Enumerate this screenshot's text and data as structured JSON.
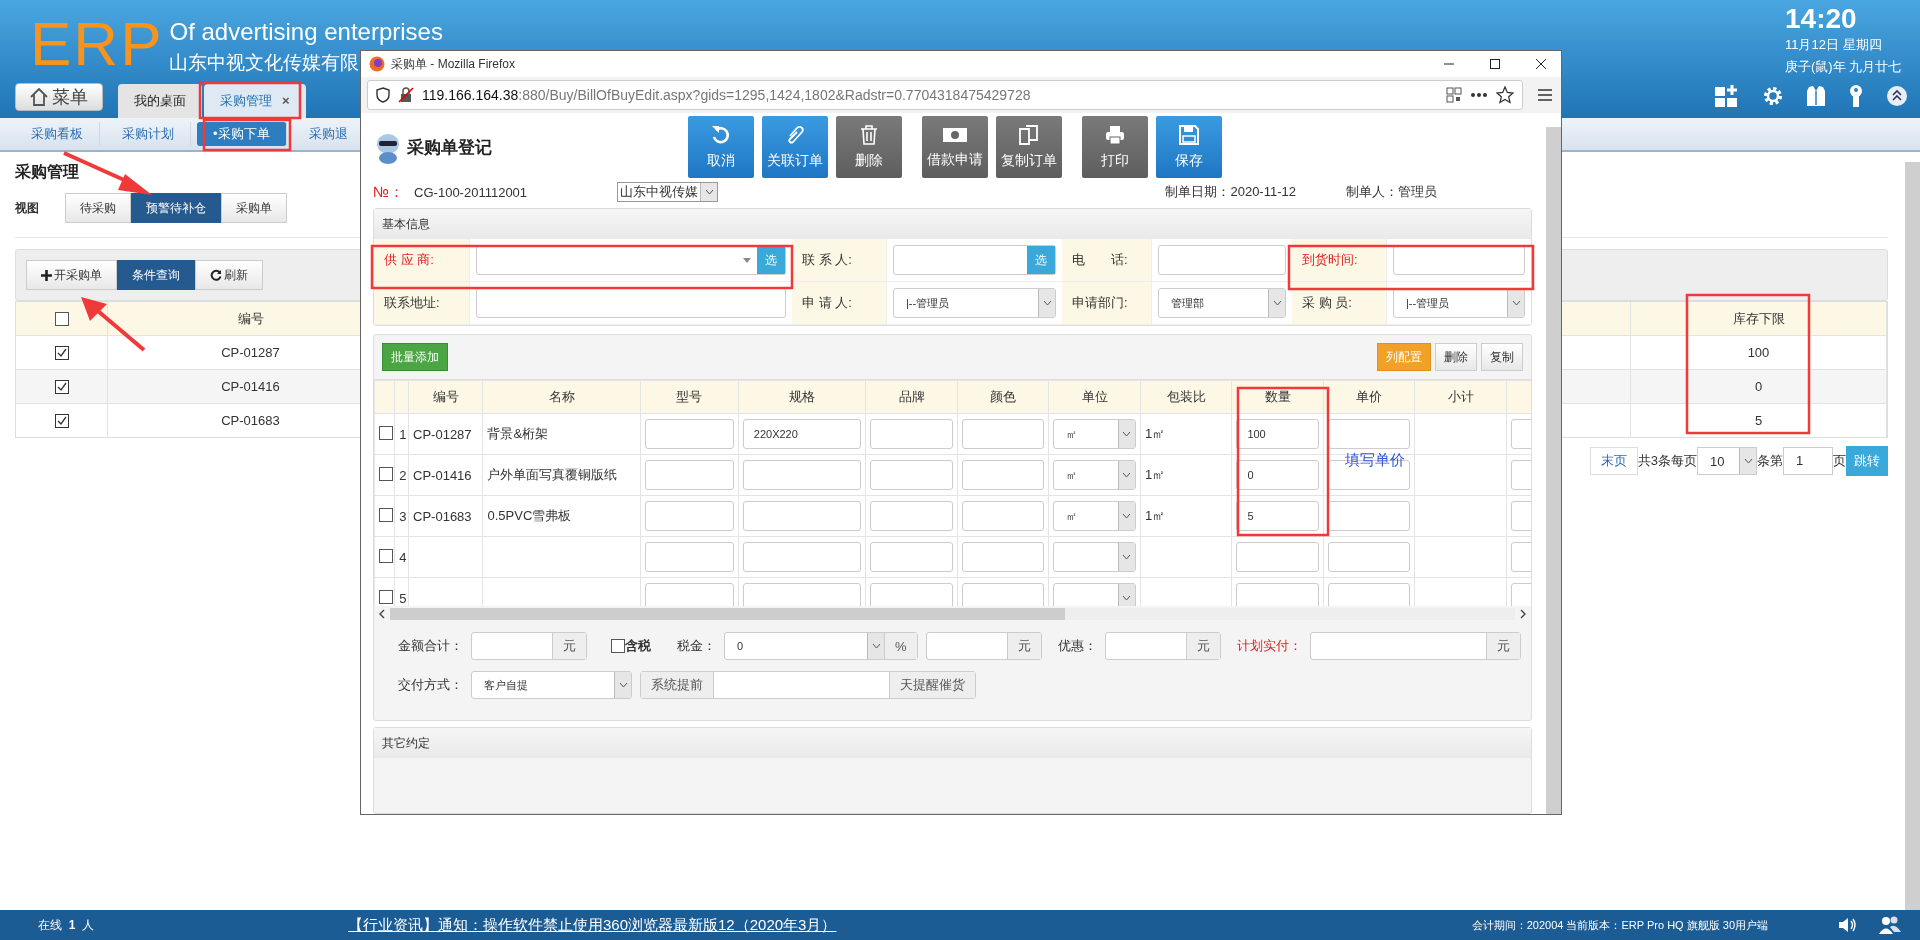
{
  "header": {
    "logo": "ERP",
    "title": "Of advertising enterprises",
    "subtitle": "山东中视文化传媒有限",
    "time": "14:20",
    "date": "11月12日 星期四",
    "lunar": "庚子(鼠)年 九月廿七"
  },
  "menu_button": "菜单",
  "tabs": [
    {
      "label": "我的桌面",
      "selected": false
    },
    {
      "label": "采购管理",
      "selected": true,
      "close": "×"
    }
  ],
  "subnav": [
    {
      "label": "采购看板",
      "selected": false
    },
    {
      "label": "采购计划",
      "selected": false
    },
    {
      "label": "•采购下单",
      "selected": true
    },
    {
      "label": "采购退",
      "selected": false
    }
  ],
  "page": {
    "title": "采购管理",
    "view_label": "视图",
    "views": [
      {
        "label": "待采购",
        "selected": false
      },
      {
        "label": "预警待补仓",
        "selected": true
      },
      {
        "label": "采购单",
        "selected": false
      }
    ],
    "toolbar": [
      {
        "label": "开采购单",
        "selected": false
      },
      {
        "label": "条件查询",
        "selected": true
      },
      {
        "label": "刷新",
        "selected": false
      }
    ],
    "table": {
      "header_checked": false,
      "columns": [
        "编号",
        "库存下限"
      ],
      "rows": [
        {
          "checked": true,
          "code": "CP-01287",
          "stock_min": "100"
        },
        {
          "checked": true,
          "code": "CP-01416",
          "stock_min": "0"
        },
        {
          "checked": true,
          "code": "CP-01683",
          "stock_min": "5"
        }
      ]
    },
    "pager": {
      "last": "末页",
      "total": "共3条每页",
      "size": "10",
      "page_prefix": "条第",
      "page": "1",
      "page_suffix": "页",
      "go": "跳转"
    }
  },
  "popup": {
    "title": "采购单 - Mozilla Firefox",
    "url_host": "119.166.164.38",
    "url_rest": ":880/Buy/BillOfBuyEdit.aspx?gids=1295,1424,1802&Radstr=0.7704318475429728",
    "form_title": "采购单登记",
    "actions": [
      "取消",
      "关联订单",
      "删除",
      "借款申请",
      "复制订单",
      "打印",
      "保存"
    ],
    "number_label": "№：",
    "number": "CG-100-201112001",
    "company": "山东中视传媒",
    "date": "制单日期：2020-11-12",
    "maker": "制单人：管理员",
    "basic_title": "基本信息",
    "fields": [
      {
        "label": "供 应 商:",
        "highlight": true,
        "kind": "combo",
        "button": "选"
      },
      {
        "label": "联 系 人:",
        "highlight": false,
        "kind": "pick",
        "button": "选"
      },
      {
        "label": "电　　话:",
        "highlight": false,
        "kind": "text"
      },
      {
        "label": "到货时间:",
        "highlight": true,
        "kind": "text"
      },
      {
        "label": "联系地址:",
        "highlight": false,
        "kind": "text"
      },
      {
        "label": "申 请 人:",
        "highlight": false,
        "kind": "select",
        "value": "|--管理员"
      },
      {
        "label": "申请部门:",
        "highlight": false,
        "kind": "select",
        "value": "管理部"
      },
      {
        "label": "采 购 员:",
        "highlight": false,
        "kind": "select",
        "value": "|--管理员"
      }
    ],
    "batch_add": "批量添加",
    "right_buttons": [
      "列配置",
      "删除",
      "复制"
    ],
    "columns": [
      "编号",
      "名称",
      "型号",
      "规格",
      "品牌",
      "颜色",
      "单位",
      "包装比",
      "数量",
      "单价",
      "小计"
    ],
    "rows": [
      {
        "checked": false,
        "no": "1",
        "code": "CP-01287",
        "name": "背景&桁架",
        "spec": "220X220",
        "unit": "㎡",
        "pack": "1㎡",
        "qty": "100"
      },
      {
        "checked": false,
        "no": "2",
        "code": "CP-01416",
        "name": "户外单面写真覆铜版纸",
        "unit": "㎡",
        "pack": "1㎡",
        "qty": "0"
      },
      {
        "checked": false,
        "no": "3",
        "code": "CP-01683",
        "name": "0.5PVC雪弗板",
        "unit": "㎡",
        "pack": "1㎡",
        "qty": "5"
      },
      {
        "checked": false,
        "no": "4"
      },
      {
        "checked": false,
        "no": "5"
      }
    ],
    "note": "填写单价",
    "totals": [
      {
        "kind": "input_unit",
        "label": "金额合计：",
        "highlight": false,
        "unit": "元"
      },
      {
        "kind": "checkbox",
        "label": "含税",
        "checked": false
      },
      {
        "kind": "select_unit",
        "label": "税金：",
        "value": "0",
        "unit": "%"
      },
      {
        "kind": "input_unit",
        "unit": "元"
      },
      {
        "kind": "input_unit",
        "label": "优惠：",
        "highlight": false,
        "unit": "元"
      },
      {
        "kind": "input_unit",
        "label": "计划实付：",
        "highlight": true,
        "unit": "元"
      }
    ],
    "delivery": {
      "label": "交付方式：",
      "value": "客户自提",
      "prefix": "系统提前",
      "suffix": "天提醒催货"
    },
    "other_title": "其它约定"
  },
  "status_bar": {
    "online_label": "在线",
    "online_count": "1",
    "online_unit": "人",
    "news": "【行业资讯】通知：操作软件禁止使用360浏览器最新版12（2020年3月）",
    "info": "会计期间：202004 当前版本：ERP Pro HQ 旗舰版 30用户端"
  }
}
